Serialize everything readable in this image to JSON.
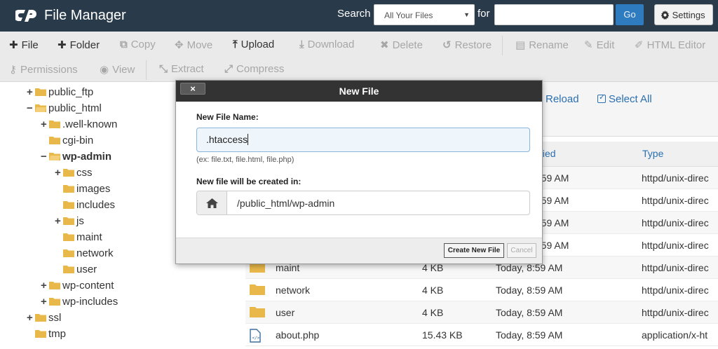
{
  "header": {
    "title": "File Manager",
    "search_label": "Search",
    "search_scope": "All Your Files",
    "for_label": "for",
    "search_value": "",
    "go_label": "Go",
    "settings_label": "Settings"
  },
  "toolbar": {
    "row1": [
      {
        "label": "File",
        "icon": "plus-icon",
        "enabled": true
      },
      {
        "label": "Folder",
        "icon": "plus-icon",
        "enabled": true
      },
      {
        "label": "Copy",
        "icon": "copy-icon",
        "enabled": false
      },
      {
        "label": "Move",
        "icon": "move-icon",
        "enabled": false
      },
      {
        "label": "Upload",
        "icon": "upload-icon",
        "enabled": true
      },
      {
        "label": "Download",
        "icon": "download-icon",
        "enabled": false
      },
      {
        "label": "Delete",
        "icon": "delete-icon",
        "enabled": false
      },
      {
        "label": "Restore",
        "icon": "restore-icon",
        "enabled": false
      },
      {
        "label": "Rename",
        "icon": "file-icon",
        "enabled": false
      },
      {
        "label": "Edit",
        "icon": "pencil-icon",
        "enabled": false
      },
      {
        "label": "HTML Editor",
        "icon": "html-editor-icon",
        "enabled": false
      }
    ],
    "row2": [
      {
        "label": "Permissions",
        "icon": "key-icon",
        "enabled": false
      },
      {
        "label": "View",
        "icon": "eye-icon",
        "enabled": false
      },
      {
        "label": "Extract",
        "icon": "extract-icon",
        "enabled": false
      },
      {
        "label": "Compress",
        "icon": "compress-icon",
        "enabled": false
      }
    ]
  },
  "tree": [
    {
      "label": "public_ftp",
      "toggle": "+"
    },
    {
      "label": "public_html",
      "toggle": "−"
    },
    {
      "label": ".well-known",
      "toggle": "+"
    },
    {
      "label": "cgi-bin",
      "toggle": ""
    },
    {
      "label": "wp-admin",
      "toggle": "−",
      "active": true
    },
    {
      "label": "css",
      "toggle": "+"
    },
    {
      "label": "images",
      "toggle": ""
    },
    {
      "label": "includes",
      "toggle": ""
    },
    {
      "label": "js",
      "toggle": "+"
    },
    {
      "label": "maint",
      "toggle": ""
    },
    {
      "label": "network",
      "toggle": ""
    },
    {
      "label": "user",
      "toggle": ""
    },
    {
      "label": "wp-content",
      "toggle": "+"
    },
    {
      "label": "wp-includes",
      "toggle": "+"
    },
    {
      "label": "ssl",
      "toggle": "+"
    },
    {
      "label": "tmp",
      "toggle": ""
    }
  ],
  "panel": {
    "reload_label": "Reload",
    "select_all_label": "Select All",
    "columns": {
      "modified_partial": "fied",
      "type": "Type"
    },
    "partial_rows": [
      {
        "modified": "8:59 AM",
        "type": "httpd/unix-direc"
      },
      {
        "modified": "8:59 AM",
        "type": "httpd/unix-direc"
      },
      {
        "modified": "8:59 AM",
        "type": "httpd/unix-direc"
      },
      {
        "modified": "8:59 AM",
        "type": "httpd/unix-direc"
      }
    ],
    "rows": [
      {
        "name": "maint",
        "size": "4 KB",
        "modified": "Today, 8:59 AM",
        "type": "httpd/unix-direc",
        "kind": "folder"
      },
      {
        "name": "network",
        "size": "4 KB",
        "modified": "Today, 8:59 AM",
        "type": "httpd/unix-direc",
        "kind": "folder"
      },
      {
        "name": "user",
        "size": "4 KB",
        "modified": "Today, 8:59 AM",
        "type": "httpd/unix-direc",
        "kind": "folder"
      },
      {
        "name": "about.php",
        "size": "15.43 KB",
        "modified": "Today, 8:59 AM",
        "type": "application/x-ht",
        "kind": "php"
      }
    ]
  },
  "modal": {
    "title": "New File",
    "close_label": "×",
    "name_label": "New File Name:",
    "name_value": ".htaccess",
    "hint": "(ex: file.txt, file.html, file.php)",
    "location_label": "New file will be created in:",
    "location_value": "/public_html/wp-admin",
    "create_label": "Create New File",
    "cancel_label": "Cancel"
  },
  "colors": {
    "header_bg": "#293a4a",
    "accent": "#2a6fb0",
    "folder": "#e8b84a"
  }
}
